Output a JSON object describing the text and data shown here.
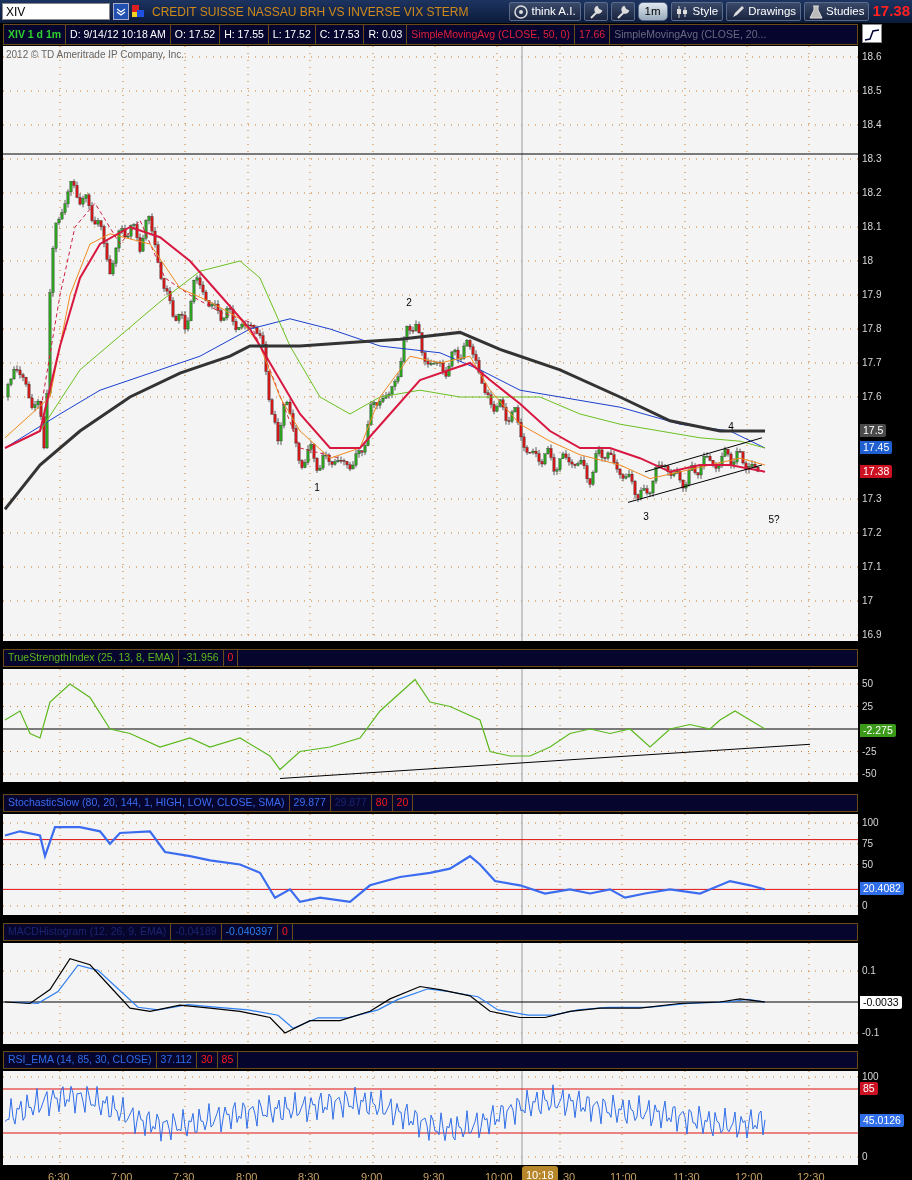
{
  "toolbar": {
    "symbol": "XIV",
    "title": "CREDIT SUISSE NASSAU BRH VS INVERSE VIX STERM",
    "buttons": [
      {
        "kind": "ai",
        "label": "think A.I."
      },
      {
        "kind": "icon"
      },
      {
        "kind": "icon"
      },
      {
        "kind": "period",
        "label": "1m"
      },
      {
        "kind": "style",
        "label": "Style"
      },
      {
        "kind": "drawings",
        "label": "Drawings"
      },
      {
        "kind": "studies",
        "label": "Studies"
      }
    ],
    "last_price": "17.38"
  },
  "legend": [
    {
      "text": "XIV 1 d 1m",
      "kind": "symbol"
    },
    {
      "text": "D: 9/14/12 10:18 AM",
      "kind": "plain"
    },
    {
      "text": "O: 17.52",
      "kind": "plain"
    },
    {
      "text": "H: 17.55",
      "kind": "plain"
    },
    {
      "text": "L: 17.52",
      "kind": "plain"
    },
    {
      "text": "C: 17.53",
      "kind": "plain"
    },
    {
      "text": "R: 0.03",
      "kind": "plain"
    },
    {
      "text": "SimpleMovingAvg (CLOSE, 50, 0)",
      "kind": "study"
    },
    {
      "text": "17.66",
      "kind": "study"
    },
    {
      "text": "SimpleMovingAvg (CLOSE, 20...",
      "kind": "dim"
    }
  ],
  "main_chart": {
    "copyright": "2012 © TD Ameritrade IP Company, Inc.",
    "y_ticks": [
      "18.6",
      "18.5",
      "18.4",
      "18.3",
      "18.2",
      "18.1",
      "18",
      "17.9",
      "17.8",
      "17.7",
      "17.6",
      "17.3",
      "17.2",
      "17.1",
      "17",
      "16.9"
    ],
    "price_badges": [
      {
        "text": "17.5",
        "color": "#4a4a4a"
      },
      {
        "text": "17.45",
        "color": "#1f5fd0"
      },
      {
        "text": "17.38",
        "color": "#cc1122"
      }
    ],
    "wave_labels": [
      "1",
      "2",
      "3",
      "4",
      "5?"
    ]
  },
  "studies": [
    {
      "kind": "tsi",
      "name": "TrueStrengthIndex (25, 13, 8, EMA)",
      "name_dim": false,
      "color": "#5cb81c",
      "values": [
        {
          "text": "-31.956",
          "kind": "value"
        },
        {
          "text": "0",
          "kind": "level"
        }
      ],
      "y_ticks": [
        "50",
        "25",
        "-25",
        "-50"
      ],
      "badges": [
        {
          "text": "-2.275",
          "color": "#3c9a1a"
        }
      ]
    },
    {
      "kind": "stoch",
      "name": "StochasticSlow (80, 20, 144, 1, HIGH, LOW, CLOSE, SMA)",
      "name_dim": false,
      "color": "#3b6cf0",
      "values": [
        {
          "text": "29.877",
          "kind": "value"
        },
        {
          "text": "29.877",
          "kind": "dim"
        },
        {
          "text": "80",
          "kind": "level"
        },
        {
          "text": "20",
          "kind": "level"
        }
      ],
      "y_ticks": [
        "100",
        "75",
        "50",
        "0"
      ],
      "badges": [
        {
          "text": "20.4082",
          "color": "#2f6ee8"
        }
      ]
    },
    {
      "kind": "macd",
      "name": "MACDHistogram (12, 26, 9, EMA)",
      "name_dim": true,
      "color": "#2f7ff0",
      "values": [
        {
          "text": "-0.04189",
          "kind": "dim"
        },
        {
          "text": "-0.040397",
          "kind": "value"
        },
        {
          "text": "0",
          "kind": "level"
        }
      ],
      "y_ticks": [
        "0.1",
        "-0.1"
      ],
      "badges": [
        {
          "text": "-0.0033",
          "color": "#ffffff"
        }
      ]
    },
    {
      "kind": "rsi",
      "name": "RSI_EMA (14, 85, 30, CLOSE)",
      "name_dim": false,
      "color": "#2f6ee8",
      "values": [
        {
          "text": "37.112",
          "kind": "value"
        },
        {
          "text": "30",
          "kind": "level"
        },
        {
          "text": "85",
          "kind": "level"
        }
      ],
      "y_ticks": [
        "100",
        "0"
      ],
      "badges": [
        {
          "text": "85",
          "color": "#cc1122"
        },
        {
          "text": "45.0126",
          "color": "#2f6ee8"
        }
      ]
    }
  ],
  "time_axis": {
    "labels": [
      {
        "text": "6:30",
        "kind": "full"
      },
      {
        "text": "7:00",
        "kind": "full"
      },
      {
        "text": "7:30",
        "kind": "full"
      },
      {
        "text": "8:00",
        "kind": "full"
      },
      {
        "text": "8:30",
        "kind": "full"
      },
      {
        "text": "9:00",
        "kind": "full"
      },
      {
        "text": "9:30",
        "kind": "full"
      },
      {
        "text": "10:00",
        "kind": "full"
      },
      {
        "text": "30",
        "kind": "partial"
      },
      {
        "text": "11:00",
        "kind": "full"
      },
      {
        "text": "11:30",
        "kind": "full"
      },
      {
        "text": "12:00",
        "kind": "full"
      },
      {
        "text": "12:30",
        "kind": "full"
      }
    ],
    "cursor_label": "10:18"
  }
}
